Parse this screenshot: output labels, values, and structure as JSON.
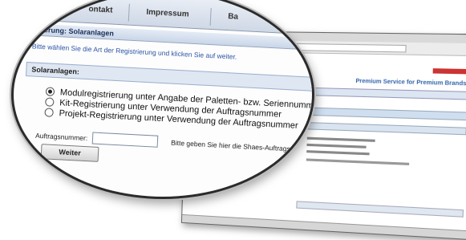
{
  "lens": {
    "tabs": [
      "ontakt",
      "Impressum",
      "Ba"
    ],
    "section_title": "strierung: Solaranlagen",
    "instruction": "Bitte wählen Sie die Art der Registrierung und klicken Sie auf weiter.",
    "panel_title": "Solaranlagen:",
    "options": [
      {
        "label": "Modulregistrierung unter Angabe der Paletten- bzw. Seriennummern",
        "selected": true
      },
      {
        "label": "Kit-Registrierung unter Verwendung der Auftragsnummer",
        "selected": false
      },
      {
        "label": "Projekt-Registrierung unter Verwendung der Auftragsnummer",
        "selected": false
      }
    ],
    "order_label": "Auftragsnummer:",
    "order_value": "",
    "order_hint": "Bitte geben Sie hier die Shaes-Auftragsnum",
    "next_button": "Weiter"
  },
  "background": {
    "heading_fragment": "n",
    "side_text_fragment": "n-",
    "brand_text": "Premium Service for Premium Brands"
  }
}
